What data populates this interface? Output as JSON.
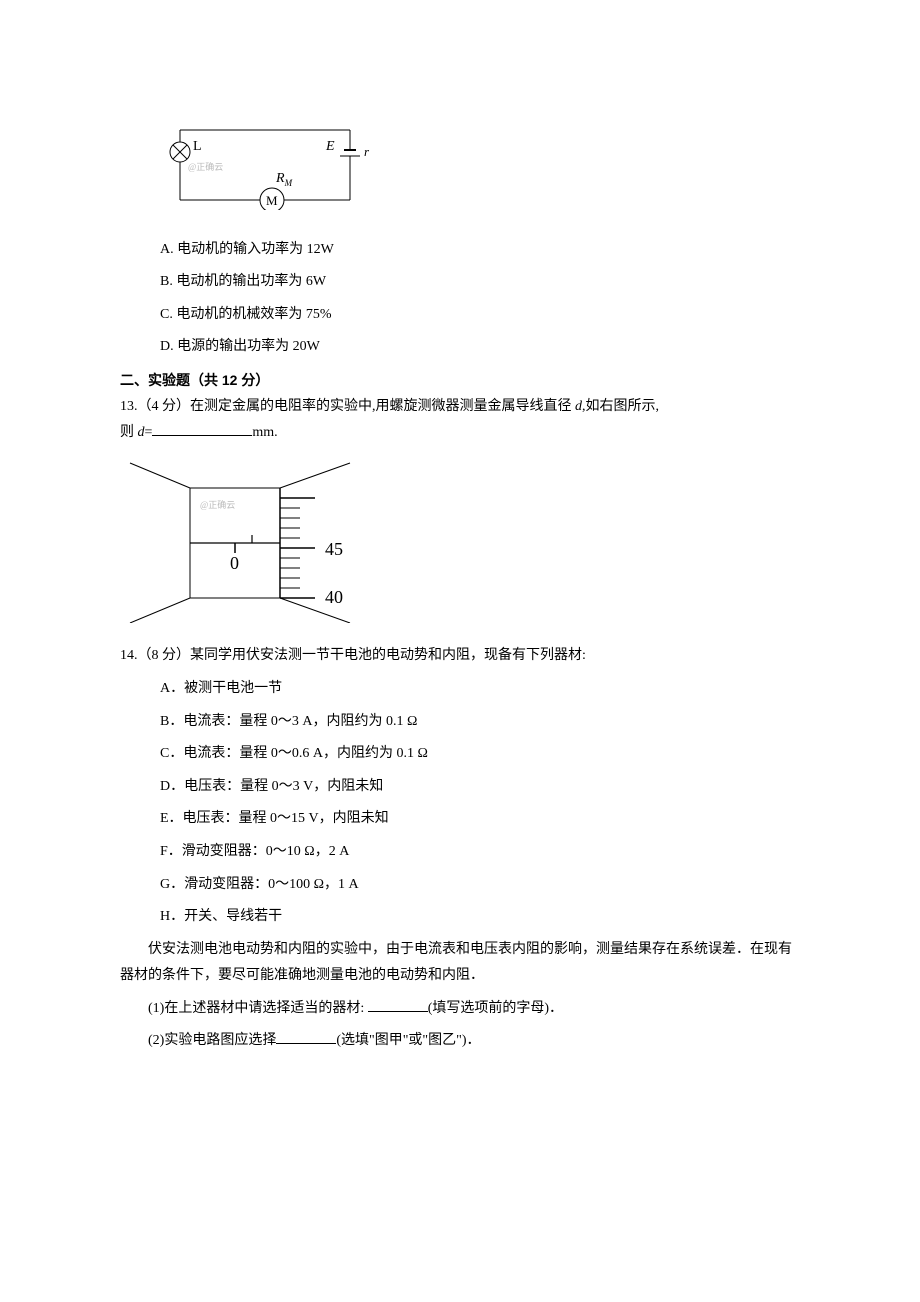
{
  "circuit1": {
    "label_L": "L",
    "label_E": "E",
    "label_r": "r",
    "label_RM": "R",
    "label_RM_sub": "M",
    "label_M": "M",
    "watermark": "@正确云"
  },
  "q12_options": {
    "A": "A. 电动机的输入功率为 12W",
    "B": "B. 电动机的输出功率为 6W",
    "C": "C. 电动机的机械效率为 75%",
    "D": "D. 电源的输出功率为 20W"
  },
  "section2_header": "二、实验题（共 12 分）",
  "q13": {
    "line1a": "13.（4 分）在测定金属的电阻率的实验中,用螺旋测微器测量金属导线直径 ",
    "d": "d",
    "line1b": ",如右图所示,",
    "line2a": "则 ",
    "line2b": "=",
    "unit": "mm."
  },
  "micrometer": {
    "main_scale": "0",
    "thimble_45": "45",
    "thimble_40": "40",
    "watermark": "@正确云"
  },
  "q14": {
    "intro": "14.（8 分）某同学用伏安法测一节干电池的电动势和内阻，现备有下列器材:",
    "options": {
      "A": "A．被测干电池一节",
      "B": "B．电流表：量程 0～3 A，内阻约为 0.1 Ω",
      "C": "C．电流表：量程 0～0.6 A，内阻约为 0.1 Ω",
      "D": "D．电压表：量程 0～3 V，内阻未知",
      "E": "E．电压表：量程 0～15 V，内阻未知",
      "F": "F．滑动变阻器：0～10 Ω，2 A",
      "G": "G．滑动变阻器：0～100 Ω，1 A",
      "H": "H．开关、导线若干"
    },
    "paragraph": "伏安法测电池电动势和内阻的实验中，由于电流表和电压表内阻的影响，测量结果存在系统误差．在现有器材的条件下，要尽可能准确地测量电池的电动势和内阻．",
    "sub1a": "(1)在上述器材中请选择适当的器材: ",
    "sub1b": "(填写选项前的字母)．",
    "sub2a": "(2)实验电路图应选择",
    "sub2b": "(选填\"图甲\"或\"图乙\")．"
  }
}
